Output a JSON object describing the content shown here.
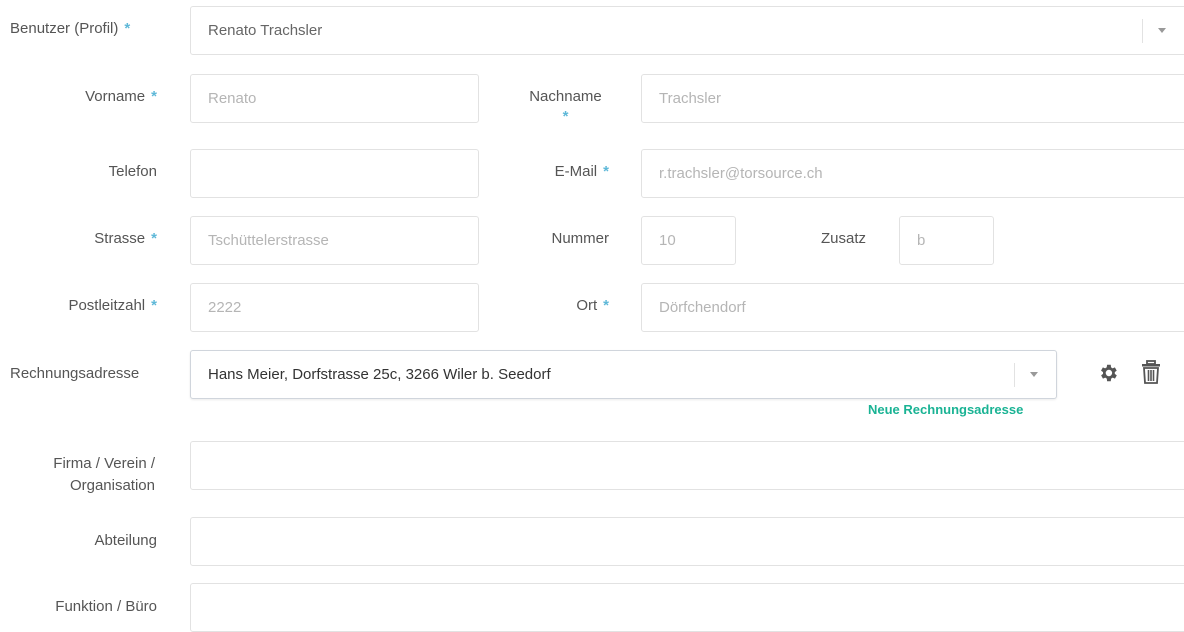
{
  "labels": {
    "benutzer": "Benutzer (Profil)",
    "vorname": "Vorname",
    "nachname": "Nachname",
    "telefon": "Telefon",
    "email": "E-Mail",
    "strasse": "Strasse",
    "nummer": "Nummer",
    "zusatz": "Zusatz",
    "plz": "Postleitzahl",
    "ort": "Ort",
    "rechnungsadresse": "Rechnungsadresse",
    "firma_line1": "Firma / Verein /",
    "firma_line2": "Organisation",
    "abteilung": "Abteilung",
    "funktion": "Funktion / Büro",
    "required_marker": "*"
  },
  "fields": {
    "benutzer": "Renato Trachsler",
    "vorname": "Renato",
    "nachname": "Trachsler",
    "telefon": "",
    "email": "r.trachsler@torsource.ch",
    "strasse": "Tschüttelerstrasse",
    "nummer": "10",
    "zusatz": "b",
    "plz": "2222",
    "ort": "Dörfchendorf",
    "rechnungsadresse": "Hans Meier, Dorfstrasse 25c, 3266 Wiler b. Seedorf",
    "firma": "",
    "abteilung": "",
    "funktion": ""
  },
  "links": {
    "neue_rechnungsadresse": "Neue Rechnungsadresse"
  },
  "icons": {
    "settings": "gear-icon",
    "delete": "trash-icon"
  },
  "colors": {
    "required": "#5eb8d8",
    "link": "#1ab394"
  }
}
